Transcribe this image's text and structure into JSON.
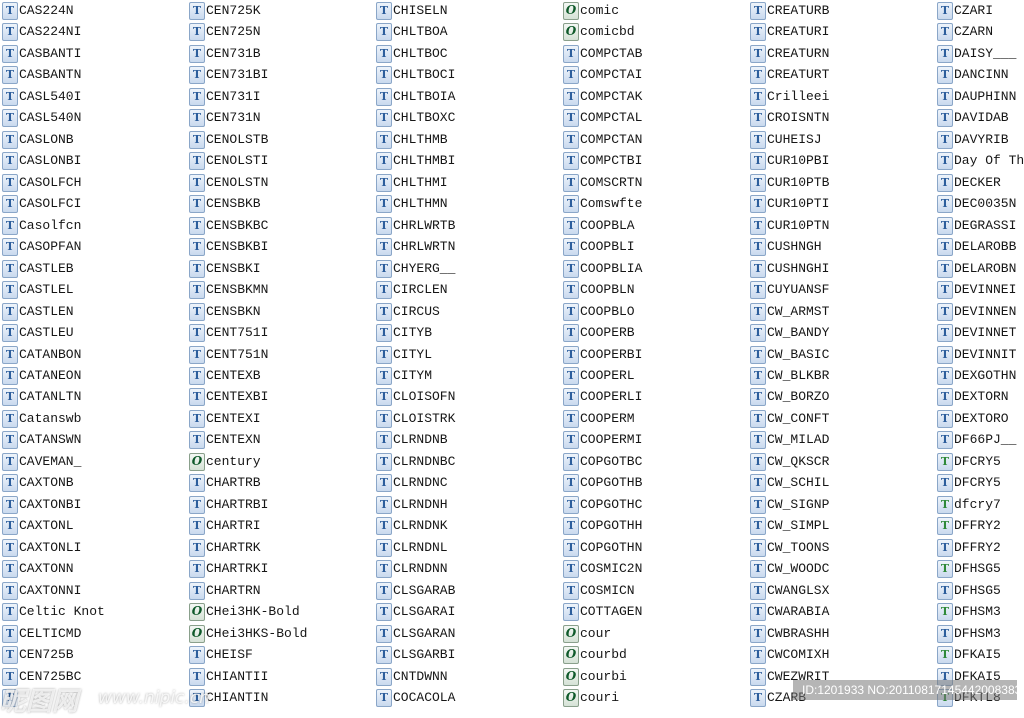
{
  "icon_types": {
    "t": "truetype-font-icon",
    "o": "opentype-font-icon",
    "g": "truetype-font-green-icon"
  },
  "colors": {
    "tt_icon": "#2d5e9c",
    "otf_icon": "#0f5a2a",
    "green_tt_icon": "#2f8a3a"
  },
  "columns": [
    [
      {
        "n": "CAS224N",
        "i": "t"
      },
      {
        "n": "CAS224NI",
        "i": "t"
      },
      {
        "n": "CASBANTI",
        "i": "t"
      },
      {
        "n": "CASBANTN",
        "i": "t"
      },
      {
        "n": "CASL540I",
        "i": "t"
      },
      {
        "n": "CASL540N",
        "i": "t"
      },
      {
        "n": "CASLONB",
        "i": "t"
      },
      {
        "n": "CASLONBI",
        "i": "t"
      },
      {
        "n": "CASOLFCH",
        "i": "t"
      },
      {
        "n": "CASOLFCI",
        "i": "t"
      },
      {
        "n": "Casolfcn",
        "i": "t"
      },
      {
        "n": "CASOPFAN",
        "i": "t"
      },
      {
        "n": "CASTLEB",
        "i": "t"
      },
      {
        "n": "CASTLEL",
        "i": "t"
      },
      {
        "n": "CASTLEN",
        "i": "t"
      },
      {
        "n": "CASTLEU",
        "i": "t"
      },
      {
        "n": "CATANBON",
        "i": "t"
      },
      {
        "n": "CATANEON",
        "i": "t"
      },
      {
        "n": "CATANLTN",
        "i": "t"
      },
      {
        "n": "Catanswb",
        "i": "t"
      },
      {
        "n": "CATANSWN",
        "i": "t"
      },
      {
        "n": "CAVEMAN_",
        "i": "t"
      },
      {
        "n": "CAXTONB",
        "i": "t"
      },
      {
        "n": "CAXTONBI",
        "i": "t"
      },
      {
        "n": "CAXTONL",
        "i": "t"
      },
      {
        "n": "CAXTONLI",
        "i": "t"
      },
      {
        "n": "CAXTONN",
        "i": "t"
      },
      {
        "n": "CAXTONNI",
        "i": "t"
      },
      {
        "n": "Celtic Knot",
        "i": "t"
      },
      {
        "n": "CELTICMD",
        "i": "t"
      },
      {
        "n": "CEN725B",
        "i": "t"
      },
      {
        "n": "CEN725BC",
        "i": "t"
      },
      {
        "n": "",
        "i": "t"
      }
    ],
    [
      {
        "n": "CEN725K",
        "i": "t"
      },
      {
        "n": "CEN725N",
        "i": "t"
      },
      {
        "n": "CEN731B",
        "i": "t"
      },
      {
        "n": "CEN731BI",
        "i": "t"
      },
      {
        "n": "CEN731I",
        "i": "t"
      },
      {
        "n": "CEN731N",
        "i": "t"
      },
      {
        "n": "CENOLSTB",
        "i": "t"
      },
      {
        "n": "CENOLSTI",
        "i": "t"
      },
      {
        "n": "CENOLSTN",
        "i": "t"
      },
      {
        "n": "CENSBKB",
        "i": "t"
      },
      {
        "n": "CENSBKBC",
        "i": "t"
      },
      {
        "n": "CENSBKBI",
        "i": "t"
      },
      {
        "n": "CENSBKI",
        "i": "t"
      },
      {
        "n": "CENSBKMN",
        "i": "t"
      },
      {
        "n": "CENSBKN",
        "i": "t"
      },
      {
        "n": "CENT751I",
        "i": "t"
      },
      {
        "n": "CENT751N",
        "i": "t"
      },
      {
        "n": "CENTEXB",
        "i": "t"
      },
      {
        "n": "CENTEXBI",
        "i": "t"
      },
      {
        "n": "CENTEXI",
        "i": "t"
      },
      {
        "n": "CENTEXN",
        "i": "t"
      },
      {
        "n": "century",
        "i": "o"
      },
      {
        "n": "CHARTRB",
        "i": "t"
      },
      {
        "n": "CHARTRBI",
        "i": "t"
      },
      {
        "n": "CHARTRI",
        "i": "t"
      },
      {
        "n": "CHARTRK",
        "i": "t"
      },
      {
        "n": "CHARTRKI",
        "i": "t"
      },
      {
        "n": "CHARTRN",
        "i": "t"
      },
      {
        "n": "CHei3HK-Bold",
        "i": "o"
      },
      {
        "n": "CHei3HKS-Bold",
        "i": "o"
      },
      {
        "n": "CHEISF",
        "i": "t"
      },
      {
        "n": "CHIANTII",
        "i": "t"
      },
      {
        "n": "CHIANTIN",
        "i": "t"
      }
    ],
    [
      {
        "n": "CHISELN",
        "i": "t"
      },
      {
        "n": "CHLTBOA",
        "i": "t"
      },
      {
        "n": "CHLTBOC",
        "i": "t"
      },
      {
        "n": "CHLTBOCI",
        "i": "t"
      },
      {
        "n": "CHLTBOIA",
        "i": "t"
      },
      {
        "n": "CHLTBOXC",
        "i": "t"
      },
      {
        "n": "CHLTHMB",
        "i": "t"
      },
      {
        "n": "CHLTHMBI",
        "i": "t"
      },
      {
        "n": "CHLTHMI",
        "i": "t"
      },
      {
        "n": "CHLTHMN",
        "i": "t"
      },
      {
        "n": "CHRLWRTB",
        "i": "t"
      },
      {
        "n": "CHRLWRTN",
        "i": "t"
      },
      {
        "n": "CHYERG__",
        "i": "t"
      },
      {
        "n": "CIRCLEN",
        "i": "t"
      },
      {
        "n": "CIRCUS",
        "i": "t"
      },
      {
        "n": "CITYB",
        "i": "t"
      },
      {
        "n": "CITYL",
        "i": "t"
      },
      {
        "n": "CITYM",
        "i": "t"
      },
      {
        "n": "CLOISOFN",
        "i": "t"
      },
      {
        "n": "CLOISTRK",
        "i": "t"
      },
      {
        "n": "CLRNDNB",
        "i": "t"
      },
      {
        "n": "CLRNDNBC",
        "i": "t"
      },
      {
        "n": "CLRNDNC",
        "i": "t"
      },
      {
        "n": "CLRNDNH",
        "i": "t"
      },
      {
        "n": "CLRNDNK",
        "i": "t"
      },
      {
        "n": "CLRNDNL",
        "i": "t"
      },
      {
        "n": "CLRNDNN",
        "i": "t"
      },
      {
        "n": "CLSGARAB",
        "i": "t"
      },
      {
        "n": "CLSGARAI",
        "i": "t"
      },
      {
        "n": "CLSGARAN",
        "i": "t"
      },
      {
        "n": "CLSGARBI",
        "i": "t"
      },
      {
        "n": "CNTDWNN",
        "i": "t"
      },
      {
        "n": "COCACOLA",
        "i": "t"
      }
    ],
    [
      {
        "n": "comic",
        "i": "o"
      },
      {
        "n": "comicbd",
        "i": "o"
      },
      {
        "n": "COMPCTAB",
        "i": "t"
      },
      {
        "n": "COMPCTAI",
        "i": "t"
      },
      {
        "n": "COMPCTAK",
        "i": "t"
      },
      {
        "n": "COMPCTAL",
        "i": "t"
      },
      {
        "n": "COMPCTAN",
        "i": "t"
      },
      {
        "n": "COMPCTBI",
        "i": "t"
      },
      {
        "n": "COMSCRTN",
        "i": "t"
      },
      {
        "n": "Comswfte",
        "i": "t"
      },
      {
        "n": "COOPBLA",
        "i": "t"
      },
      {
        "n": "COOPBLI",
        "i": "t"
      },
      {
        "n": "COOPBLIA",
        "i": "t"
      },
      {
        "n": "COOPBLN",
        "i": "t"
      },
      {
        "n": "COOPBLO",
        "i": "t"
      },
      {
        "n": "COOPERB",
        "i": "t"
      },
      {
        "n": "COOPERBI",
        "i": "t"
      },
      {
        "n": "COOPERL",
        "i": "t"
      },
      {
        "n": "COOPERLI",
        "i": "t"
      },
      {
        "n": "COOPERM",
        "i": "t"
      },
      {
        "n": "COOPERMI",
        "i": "t"
      },
      {
        "n": "COPGOTBC",
        "i": "t"
      },
      {
        "n": "COPGOTHB",
        "i": "t"
      },
      {
        "n": "COPGOTHC",
        "i": "t"
      },
      {
        "n": "COPGOTHH",
        "i": "t"
      },
      {
        "n": "COPGOTHN",
        "i": "t"
      },
      {
        "n": "COSMIC2N",
        "i": "t"
      },
      {
        "n": "COSMICN",
        "i": "t"
      },
      {
        "n": "COTTAGEN",
        "i": "t"
      },
      {
        "n": "cour",
        "i": "o"
      },
      {
        "n": "courbd",
        "i": "o"
      },
      {
        "n": "courbi",
        "i": "o"
      },
      {
        "n": "couri",
        "i": "o"
      }
    ],
    [
      {
        "n": "CREATURB",
        "i": "t"
      },
      {
        "n": "CREATURI",
        "i": "t"
      },
      {
        "n": "CREATURN",
        "i": "t"
      },
      {
        "n": "CREATURT",
        "i": "t"
      },
      {
        "n": "Crilleei",
        "i": "t"
      },
      {
        "n": "CROISNTN",
        "i": "t"
      },
      {
        "n": "CUHEISJ",
        "i": "t"
      },
      {
        "n": "CUR10PBI",
        "i": "t"
      },
      {
        "n": "CUR10PTB",
        "i": "t"
      },
      {
        "n": "CUR10PTI",
        "i": "t"
      },
      {
        "n": "CUR10PTN",
        "i": "t"
      },
      {
        "n": "CUSHNGH",
        "i": "t"
      },
      {
        "n": "CUSHNGHI",
        "i": "t"
      },
      {
        "n": "CUYUANSF",
        "i": "t"
      },
      {
        "n": "CW_ARMST",
        "i": "t"
      },
      {
        "n": "CW_BANDY",
        "i": "t"
      },
      {
        "n": "CW_BASIC",
        "i": "t"
      },
      {
        "n": "CW_BLKBR",
        "i": "t"
      },
      {
        "n": "CW_BORZO",
        "i": "t"
      },
      {
        "n": "CW_CONFT",
        "i": "t"
      },
      {
        "n": "CW_MILAD",
        "i": "t"
      },
      {
        "n": "CW_QKSCR",
        "i": "t"
      },
      {
        "n": "CW_SCHIL",
        "i": "t"
      },
      {
        "n": "CW_SIGNP",
        "i": "t"
      },
      {
        "n": "CW_SIMPL",
        "i": "t"
      },
      {
        "n": "CW_TOONS",
        "i": "t"
      },
      {
        "n": "CW_WOODC",
        "i": "t"
      },
      {
        "n": "CWANGLSX",
        "i": "t"
      },
      {
        "n": "CWARABIA",
        "i": "t"
      },
      {
        "n": "CWBRASHH",
        "i": "t"
      },
      {
        "n": "CWCOMIXH",
        "i": "t"
      },
      {
        "n": "CWEZWRIT",
        "i": "t"
      },
      {
        "n": "CZARB",
        "i": "t"
      }
    ],
    [
      {
        "n": "CZARI",
        "i": "t"
      },
      {
        "n": "CZARN",
        "i": "t"
      },
      {
        "n": "DAISY___",
        "i": "t"
      },
      {
        "n": "DANCINN",
        "i": "t"
      },
      {
        "n": "DAUPHINN",
        "i": "t"
      },
      {
        "n": "DAVIDAB",
        "i": "t"
      },
      {
        "n": "DAVYRIB",
        "i": "t"
      },
      {
        "n": "Day Of Th",
        "i": "t"
      },
      {
        "n": "DECKER",
        "i": "t"
      },
      {
        "n": "DEC0035N",
        "i": "t"
      },
      {
        "n": "DEGRASSI",
        "i": "t"
      },
      {
        "n": "DELAROBB",
        "i": "t"
      },
      {
        "n": "DELAROBN",
        "i": "t"
      },
      {
        "n": "DEVINNEI",
        "i": "t"
      },
      {
        "n": "DEVINNEN",
        "i": "t"
      },
      {
        "n": "DEVINNET",
        "i": "t"
      },
      {
        "n": "DEVINNIT",
        "i": "t"
      },
      {
        "n": "DEXGOTHN",
        "i": "t"
      },
      {
        "n": "DEXTORN",
        "i": "t"
      },
      {
        "n": "DEXTORO",
        "i": "t"
      },
      {
        "n": "DF66PJ__",
        "i": "t"
      },
      {
        "n": "DFCRY5",
        "i": "g"
      },
      {
        "n": "DFCRY5",
        "i": "t"
      },
      {
        "n": "dfcry7",
        "i": "g"
      },
      {
        "n": "DFFRY2",
        "i": "g"
      },
      {
        "n": "DFFRY2",
        "i": "t"
      },
      {
        "n": "DFHSG5",
        "i": "g"
      },
      {
        "n": "DFHSG5",
        "i": "t"
      },
      {
        "n": "DFHSM3",
        "i": "g"
      },
      {
        "n": "DFHSM3",
        "i": "t"
      },
      {
        "n": "DFKAI5",
        "i": "g"
      },
      {
        "n": "DFKAI5",
        "i": "t"
      },
      {
        "n": "DFKTL8",
        "i": "g"
      }
    ]
  ],
  "watermark": {
    "logo": "昵图网",
    "site": "www.nipic.cn",
    "id": "ID:1201933 NO:20110817145442008383"
  }
}
